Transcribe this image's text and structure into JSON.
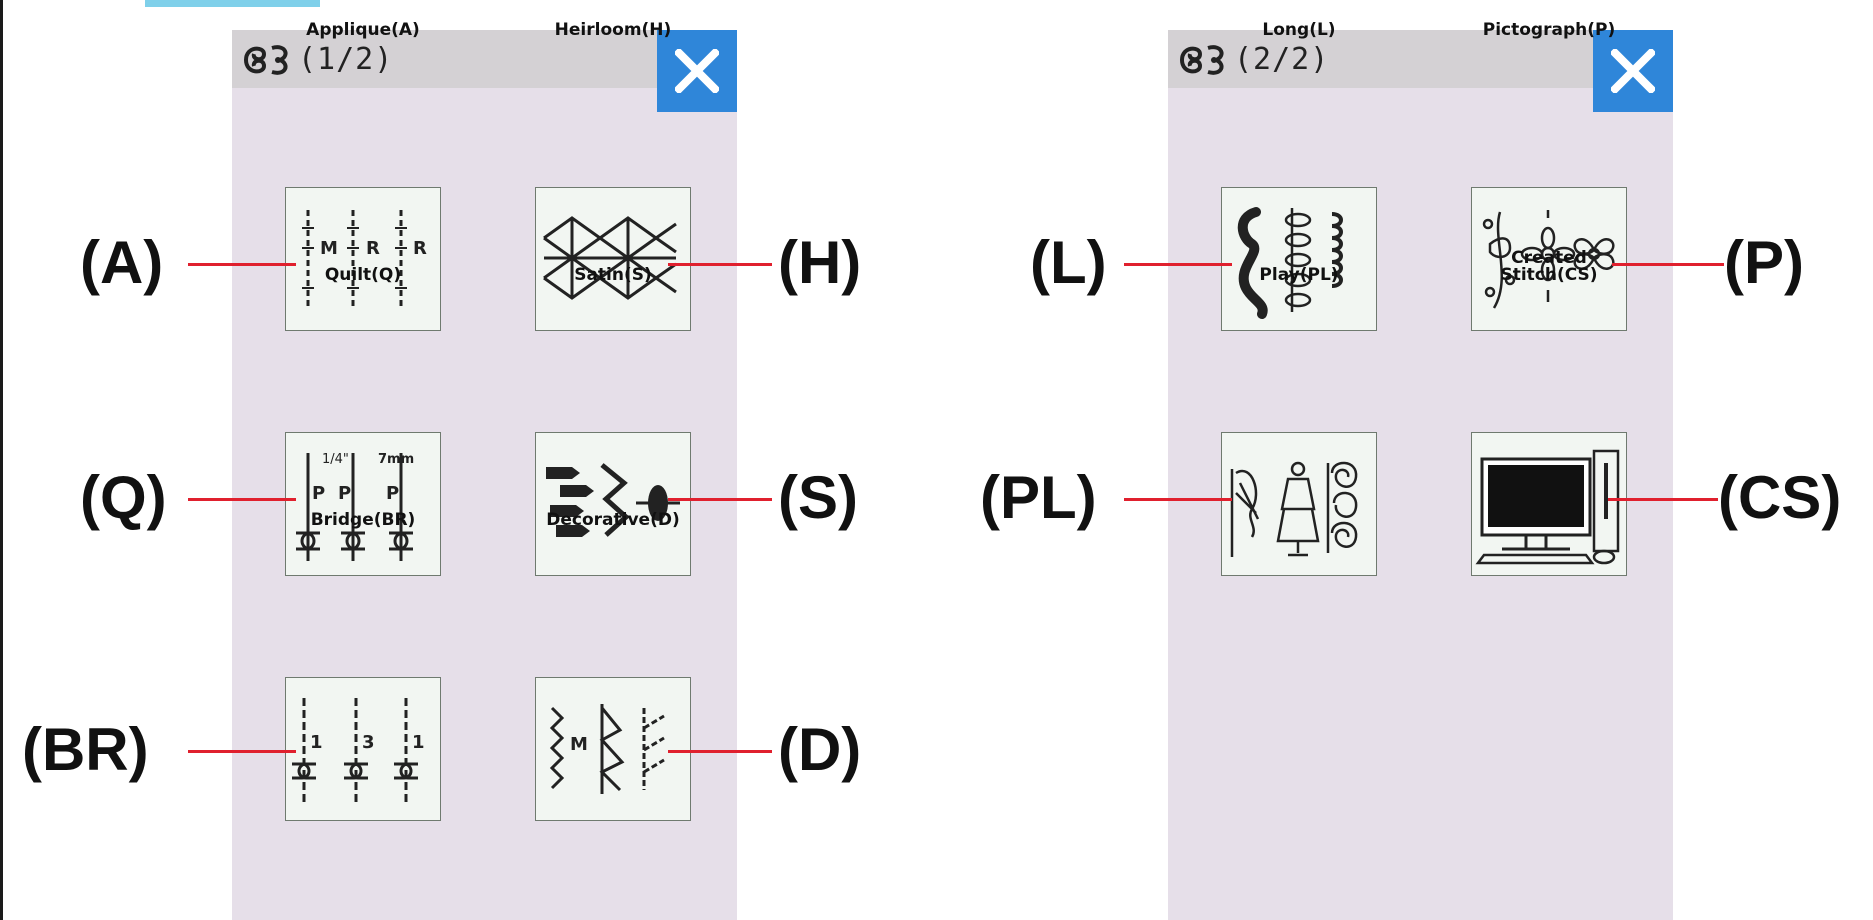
{
  "panels": [
    {
      "title": "(1/2)",
      "icon": "stitch-pattern-icon",
      "close_icon": "close-icon",
      "categories": [
        {
          "label": "Applique(A)",
          "callout": "(A)",
          "icon": "applique-stitch-icon",
          "glyph_letters": [
            "M",
            "R",
            "R"
          ]
        },
        {
          "label": "Heirloom(H)",
          "callout": "(H)",
          "icon": "heirloom-stitch-icon"
        },
        {
          "label": "Quilt(Q)",
          "callout": "(Q)",
          "icon": "quilt-stitch-icon",
          "glyph_letters": [
            "1/4\"",
            "7mm",
            "P",
            "P",
            "P"
          ]
        },
        {
          "label": "Satin(S)",
          "callout": "(S)",
          "icon": "satin-stitch-icon"
        },
        {
          "label": "Bridge(BR)",
          "callout": "(BR)",
          "icon": "bridge-stitch-icon",
          "glyph_letters": [
            "1",
            "3",
            "1"
          ]
        },
        {
          "label": "Decorative(D)",
          "callout": "(D)",
          "icon": "decorative-stitch-icon",
          "glyph_letters": [
            "M"
          ]
        }
      ]
    },
    {
      "title": "(2/2)",
      "icon": "stitch-pattern-icon",
      "close_icon": "close-icon",
      "categories": [
        {
          "label": "Long(L)",
          "callout": "(L)",
          "icon": "long-stitch-icon"
        },
        {
          "label": "Pictograph(P)",
          "callout": "(P)",
          "icon": "pictograph-stitch-icon"
        },
        {
          "label": "Play(PL)",
          "callout": "(PL)",
          "icon": "play-stitch-icon"
        },
        {
          "label": "Created Stitch(CS)",
          "label_lines": [
            "Created",
            "Stitch(CS)"
          ],
          "callout": "(CS)",
          "icon": "computer-monitor-icon"
        }
      ]
    }
  ],
  "colors": {
    "panel_bg": "#e6dfe9",
    "header_bg": "#d4d1d4",
    "close_button": "#2f86d9",
    "leader_line": "#e0202e",
    "tile_bg": "#f2f6f2"
  }
}
